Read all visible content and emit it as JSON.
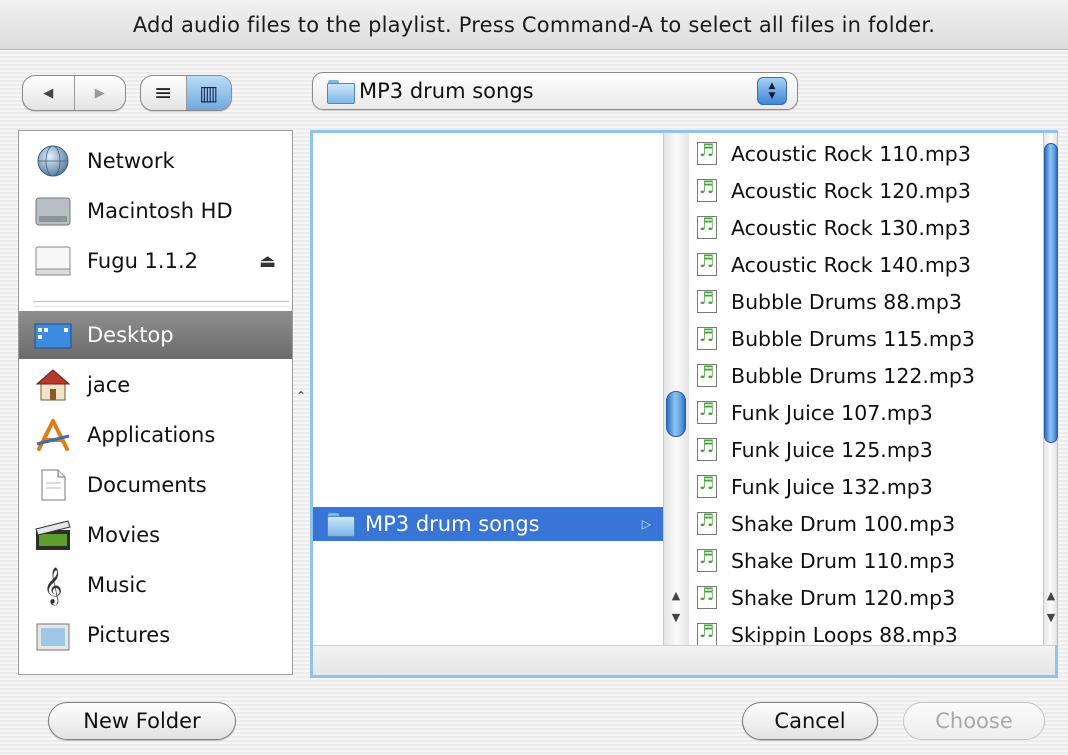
{
  "dialog": {
    "title": "Add audio files to the playlist. Press Command-A to select all files in folder."
  },
  "toolbar": {
    "back_icon": "◀",
    "forward_icon": "▶",
    "list_view_icon": "≡",
    "column_view_icon": "▥",
    "location": "MP3 drum songs"
  },
  "sidebar": {
    "devices": [
      {
        "label": "Network",
        "icon": "network-globe-icon"
      },
      {
        "label": "Macintosh HD",
        "icon": "hard-drive-icon"
      },
      {
        "label": "Fugu 1.1.2",
        "icon": "disk-image-icon",
        "eject": "⏏"
      }
    ],
    "places": [
      {
        "label": "Desktop",
        "icon": "desktop-icon",
        "selected": true
      },
      {
        "label": "jace",
        "icon": "home-icon"
      },
      {
        "label": "Applications",
        "icon": "applications-icon"
      },
      {
        "label": "Documents",
        "icon": "documents-icon"
      },
      {
        "label": "Movies",
        "icon": "movies-icon"
      },
      {
        "label": "Music",
        "icon": "music-icon"
      },
      {
        "label": "Pictures",
        "icon": "pictures-icon"
      }
    ]
  },
  "browser": {
    "column1": {
      "selected_folder": "MP3 drum songs",
      "disclosure": "▷"
    },
    "column2": {
      "files": [
        "Acoustic Rock 110.mp3",
        "Acoustic Rock 120.mp3",
        "Acoustic Rock 130.mp3",
        "Acoustic Rock 140.mp3",
        "Bubble Drums 88.mp3",
        "Bubble Drums 115.mp3",
        "Bubble Drums 122.mp3",
        "Funk Juice 107.mp3",
        "Funk Juice 125.mp3",
        "Funk Juice 132.mp3",
        "Shake Drum 100.mp3",
        "Shake Drum 110.mp3",
        "Shake Drum 120.mp3",
        "Skippin Loops 88.mp3"
      ]
    }
  },
  "buttons": {
    "new_folder": "New Folder",
    "cancel": "Cancel",
    "choose": "Choose"
  },
  "colors": {
    "selection_blue": "#3875d7",
    "sidebar_selection_gray": "#7c7c7c",
    "focus_ring": "#8ec3ee"
  }
}
